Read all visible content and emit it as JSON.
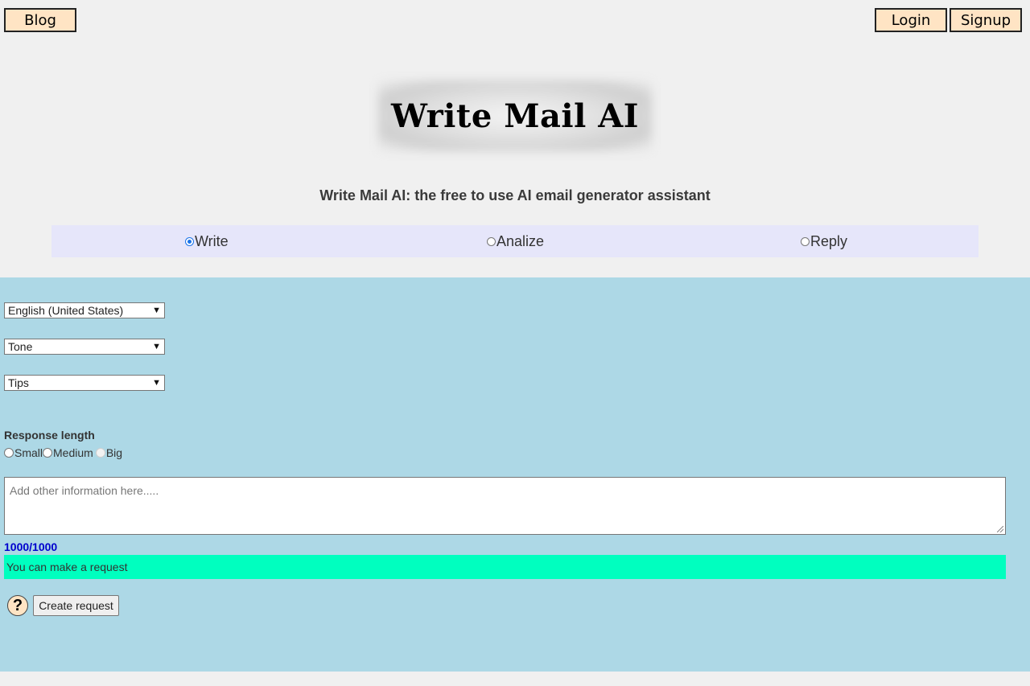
{
  "nav": {
    "blog": "Blog",
    "login": "Login",
    "signup": "Signup"
  },
  "logo": {
    "text": "Write Mail AI"
  },
  "subtitle": "Write Mail AI: the free to use AI email generator assistant",
  "modes": [
    {
      "label": "Write",
      "checked": true
    },
    {
      "label": "Analize",
      "checked": false
    },
    {
      "label": "Reply",
      "checked": false
    }
  ],
  "form": {
    "language": "English (United States)",
    "tone": "Tone",
    "tips": "Tips",
    "response_length": {
      "label": "Response length",
      "options": [
        "Small",
        "Medium",
        "Big"
      ]
    },
    "textarea_placeholder": "Add other information here.....",
    "counter": "1000/1000",
    "status": "You can make a request",
    "help_symbol": "?",
    "create_button": "Create request"
  },
  "colors": {
    "nav_button_bg": "#ffe4c4",
    "mode_bar_bg": "#e6e6fa",
    "panel_bg": "#add8e6",
    "status_bg": "#00ffbf",
    "counter_text": "#0000cd"
  },
  "icons": {
    "help": "question-mark-icon",
    "select_caret": "chevron-down-icon"
  }
}
